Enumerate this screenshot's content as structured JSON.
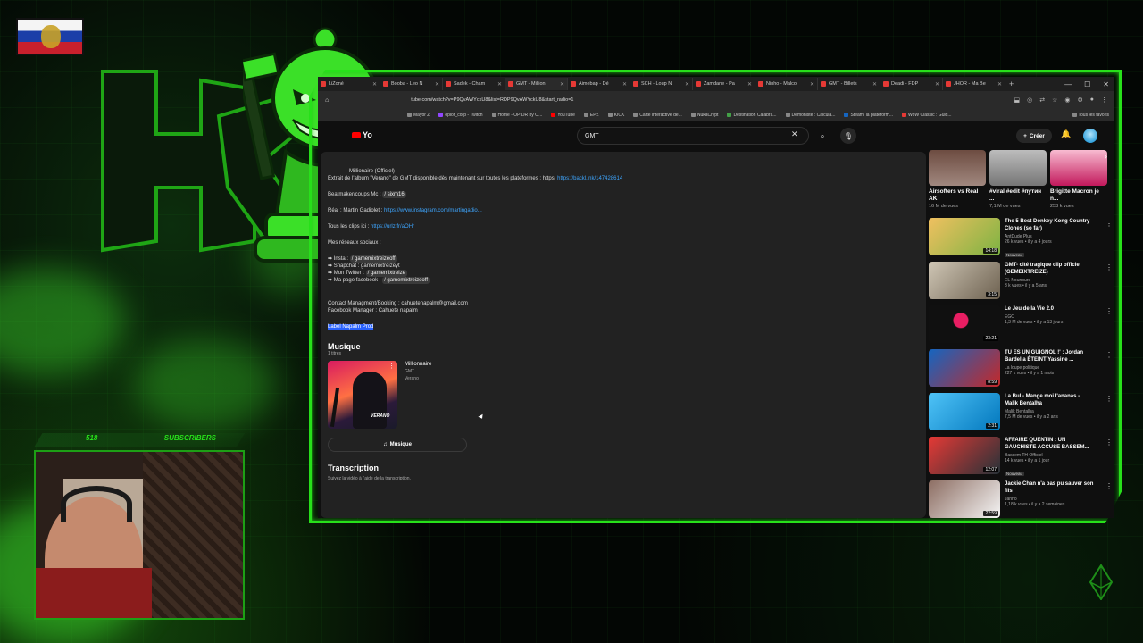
{
  "browser": {
    "tabs": [
      {
        "label": "LiZoné"
      },
      {
        "label": "Booba - Leo N"
      },
      {
        "label": "Sadek - Cham"
      },
      {
        "label": "GMT - Million"
      },
      {
        "label": "Aimebap - Dé"
      },
      {
        "label": "SCH - Loup N"
      },
      {
        "label": "Zamdane - Pa"
      },
      {
        "label": "Ninho - Malco"
      },
      {
        "label": "GMT - Billets"
      },
      {
        "label": "Deadi - FDP"
      },
      {
        "label": "JHOR - Ma Be"
      }
    ],
    "url": "tube.com/watch?v=P9QvAWYckU8&list=RDP9QvAWYckU8&start_radio=1",
    "bookmarks": [
      {
        "label": "Mayor Z"
      },
      {
        "label": "opior_corp - Twitch"
      },
      {
        "label": "Home - OPIDR by O..."
      },
      {
        "label": "YouTube"
      },
      {
        "label": "EPZ"
      },
      {
        "label": "KICK"
      },
      {
        "label": "Carte interactive de..."
      },
      {
        "label": "NukaCrypt"
      },
      {
        "label": "Destination Calabra..."
      },
      {
        "label": "Démoniste : Calcula..."
      },
      {
        "label": "Steam, la plateform..."
      },
      {
        "label": "WoW Classic : Guid..."
      }
    ],
    "bookmarks_folder": "Tous les favoris"
  },
  "youtube": {
    "logo": "Yo",
    "search_value": "GMT",
    "create_label": "Créer"
  },
  "description": {
    "line1": "Millionaire (Officiel)",
    "line2_prefix": "Extrait de l'album \"Verano\" de GMT disponible dès maintenant sur toutes les plateformes : https:",
    "line2_link": "https://backl.ink/147428614",
    "line3_prefix": "Beatmaker/coups Mc :",
    "line3_chip": "/ sixm16",
    "line4_prefix": "Réal : Martin Gadiolet :",
    "line4_link": "https://www.instagram.com/martingadio...",
    "line5_prefix": "Tous les clips ici :",
    "line5_link": "https://urlz.fr/aOHr",
    "line6": "Mes réseaux sociaux :",
    "social1": "➡ Insta :",
    "social1_chip": "/ gamemixtreizeoff",
    "social2": "➡ Snapchat : gamemixtreizeyt",
    "social3": "➡ Mon Twitter :",
    "social3_chip": "/ gamemixtreize",
    "social4": "➡ Ma page facebook :",
    "social4_chip": "/ gamemixtreizeoff",
    "contact1": "Contact Managment/Booking : cahuetenapalm@gmail.com",
    "contact2": "Facebook Manager : Cahuete napalm",
    "label": "Label Napalm Prod",
    "music_heading": "Musique",
    "music_count": "1 titres",
    "track_title": "Millionnaire",
    "track_artist": "GMT",
    "track_album": "Verano",
    "cover_text": "VERANO",
    "music_button": "Musique",
    "transcript_heading": "Transcription",
    "transcript_sub": "Suivez la vidéo à l'aide de la transcription."
  },
  "shorts": [
    {
      "title": "Airsofters vs Real AK",
      "views": "16 M de vues",
      "color": "#6d4c41"
    },
    {
      "title": "#viral #edit #путин ...",
      "views": "7,1 M de vues",
      "color": "#9e9e9e"
    },
    {
      "title": "Brigitte Macron je n...",
      "views": "253 k vues",
      "color": "#c2185b"
    }
  ],
  "related": [
    {
      "title": "The 5 Best Donkey Kong Country Clones (so far)",
      "channel": "AntDude Plus",
      "meta": "26 k vues • il y a 4 jours",
      "badge": "Nouveau",
      "duration": "14:18",
      "color": "#d4a13a"
    },
    {
      "title": "GMT- cité tragique clip officiel (GEMEIXTREIZE)",
      "channel": "EL Nounours",
      "meta": "3 k vues • il y a 5 ans",
      "badge": "",
      "duration": "3:15",
      "color": "#8a7d6a"
    },
    {
      "title": "Le Jeu de la Vie 2.0",
      "channel": "EGO",
      "meta": "1,3 M de vues • il y a 13 jours",
      "badge": "",
      "duration": "23:21",
      "color": "#101010"
    },
    {
      "title": "TU ES UN GUIGNOL !' : Jordan Bardella ÉTEINT Yassine ...",
      "channel": "La loupe politique",
      "meta": "227 k vues • il y a 1 mois",
      "badge": "",
      "duration": "8:59",
      "color": "#c62828"
    },
    {
      "title": "La Bul - Mange moi l'ananas - Malik Bentalha",
      "channel": "Malik Bentalha",
      "meta": "7,5 M de vues • il y a 2 ans",
      "badge": "",
      "duration": "2:31",
      "color": "#29b6f6"
    },
    {
      "title": "AFFAIRE QUENTIN : UN GAUCHISTE ACCUSE BASSEM...",
      "channel": "Bassem TH Officiel",
      "meta": "14 k vues • il y a 1 jour",
      "badge": "Nouveau",
      "duration": "12:07",
      "color": "#b71c1c"
    },
    {
      "title": "Jackie Chan n'a pas pu sauver son fils",
      "channel": "Jahno",
      "meta": "1,18 k vues • il y a 2 semaines",
      "badge": "",
      "duration": "22:59",
      "color": "#5d4037"
    }
  ],
  "overlay": {
    "subs_count": "518",
    "subs_label": "SUBSCRIBERS"
  },
  "colors": {
    "neon": "#27e01a",
    "yt_bg": "#0f0f0f",
    "link": "#3ea6ff"
  }
}
